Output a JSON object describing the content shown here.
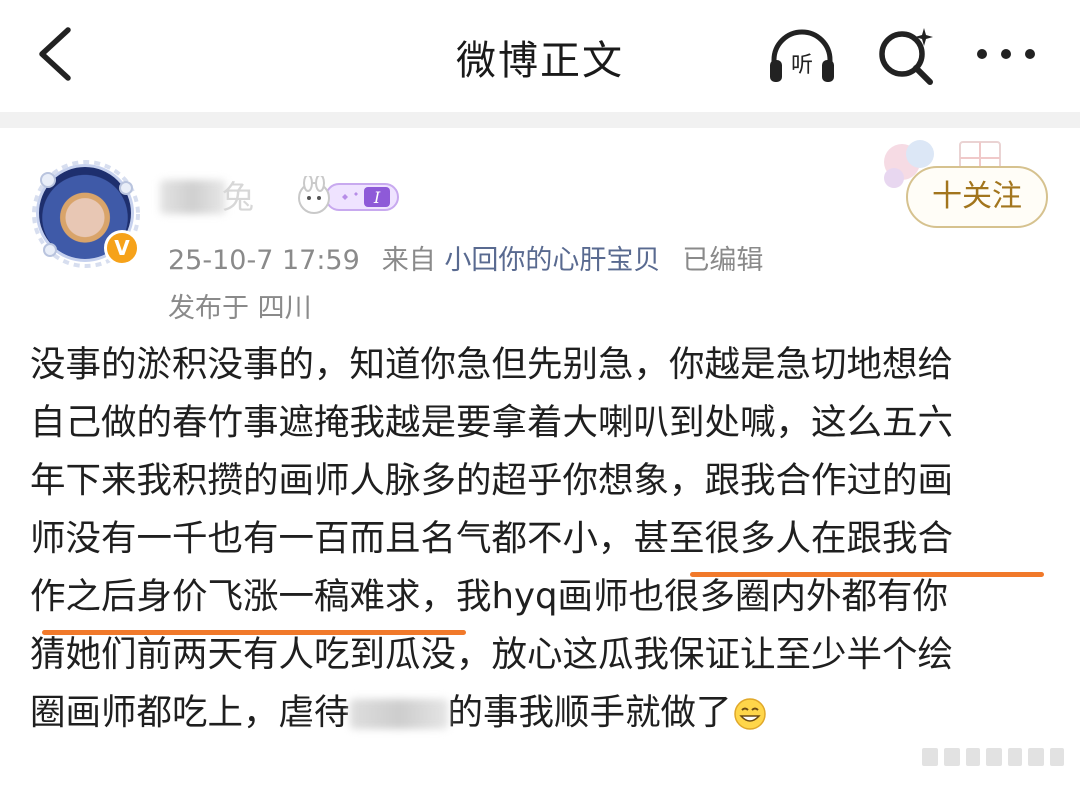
{
  "header": {
    "title": "微博正文",
    "listen_label": "听"
  },
  "post": {
    "username_visible": "兔",
    "vip_badge": "V",
    "member_badge": "I",
    "timestamp": "25-10-7 17:59",
    "from_label": "来自",
    "source": "小回你的心肝宝贝",
    "edited": "已编辑",
    "location": "发布于 四川",
    "follow_label": "十关注",
    "lines": [
      "没事的淤积没事的，知道你急但先别急，你越是急切地想给",
      "自己做的春竹事遮掩我越是要拿着大喇叭到处喊，这么五六",
      "年下来我积攒的画师人脉多的超乎你想象，跟我合作过的画"
    ],
    "line4_plain": "师没有一千也有一百而且名气都不小，",
    "line4_hl": "甚至很多人在跟我合",
    "line5_hl": "作之后身价飞涨一稿难求",
    "line5_plain": "，我hyq画师也很多圈内外都有你",
    "line6": "猜她们前两天有人吃到瓜没，放心这瓜我保证让至少半个绘",
    "line7_before": "圈画师都吃上，虐待",
    "line7_after": "的事我顺手就做了"
  },
  "colors": {
    "underline": "#f1792a",
    "source_link": "#596a90",
    "follow_text": "#a2751d",
    "vip": "#f6a21a"
  },
  "icons": [
    "back-icon",
    "headphones-icon",
    "search-sparkle-icon",
    "more-icon",
    "grin-emoji-icon"
  ]
}
